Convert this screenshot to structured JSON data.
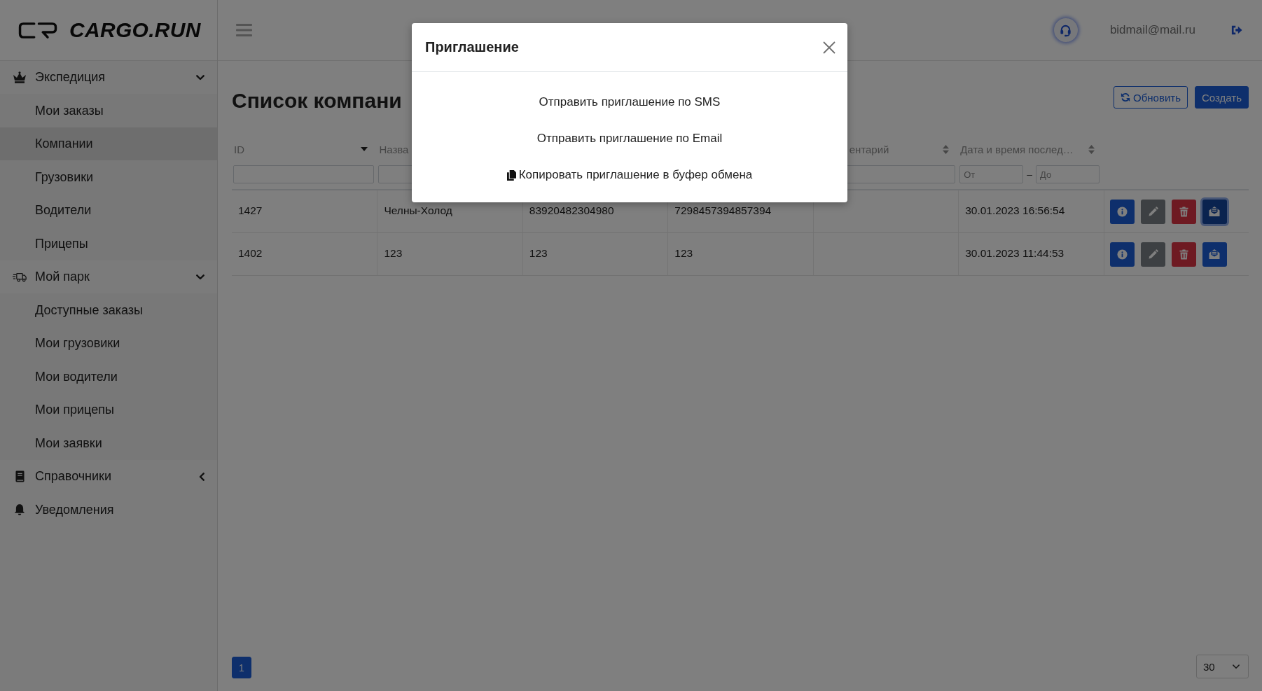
{
  "sidebar": {
    "logo": "CARGO.RUN",
    "items": [
      {
        "kind": "group",
        "label": "Экспедиция",
        "expanded": true,
        "children": [
          {
            "label": "Мои заказы",
            "selected": false
          },
          {
            "label": "Компании",
            "selected": true
          },
          {
            "label": "Грузовики",
            "selected": false
          },
          {
            "label": "Водители",
            "selected": false
          },
          {
            "label": "Прицепы",
            "selected": false
          }
        ]
      },
      {
        "kind": "group",
        "label": "Мой парк",
        "expanded": true,
        "children": [
          {
            "label": "Доступные заказы",
            "selected": false
          },
          {
            "label": "Мои грузовики",
            "selected": false
          },
          {
            "label": "Мои водители",
            "selected": false
          },
          {
            "label": "Мои прицепы",
            "selected": false
          },
          {
            "label": "Мои заявки",
            "selected": false
          }
        ]
      },
      {
        "kind": "group",
        "label": "Справочники",
        "expanded": false
      },
      {
        "kind": "link",
        "label": "Уведомления"
      }
    ]
  },
  "header": {
    "user_email": "bidmail@mail.ru"
  },
  "page": {
    "title": "Список компани",
    "buttons": [
      {
        "kind": "refresh",
        "label": "Обновить"
      },
      {
        "kind": "create",
        "label": "Создать"
      }
    ]
  },
  "table": {
    "columns": [
      {
        "kind": "data",
        "label": "ID",
        "sorted": true,
        "filter": {
          "kind": "text"
        }
      },
      {
        "kind": "data",
        "label": "Назва",
        "filter": {
          "kind": "text"
        }
      },
      {
        "kind": "covered"
      },
      {
        "kind": "covered"
      },
      {
        "kind": "data",
        "label": "ентарий",
        "sorted": false,
        "filter": {
          "kind": "text"
        }
      },
      {
        "kind": "data",
        "label": "Дата и время послед…",
        "sorted": false,
        "filter": {
          "kind": "range",
          "from_placeholder": "От",
          "separator": "–",
          "to_placeholder": "До"
        }
      },
      {
        "kind": "actions"
      }
    ],
    "rows": [
      {
        "cells": [
          "1427",
          "Челны-Холод",
          "83920482304980",
          "7298457394857394",
          null,
          "30.01.2023 16:56:54"
        ],
        "actions": [
          {
            "kind": "info",
            "active": false
          },
          {
            "kind": "edit",
            "active": false
          },
          {
            "kind": "delete",
            "active": false
          },
          {
            "kind": "invite",
            "active": true
          }
        ]
      },
      {
        "cells": [
          "1402",
          "123",
          "123",
          "123",
          null,
          "30.01.2023 11:44:53"
        ],
        "actions": [
          {
            "kind": "info",
            "active": false
          },
          {
            "kind": "edit",
            "active": false
          },
          {
            "kind": "delete",
            "active": false
          },
          {
            "kind": "invite",
            "active": false
          }
        ]
      }
    ]
  },
  "pagination": {
    "pages": [
      {
        "label": "1",
        "selected": true
      }
    ],
    "page_size": "30"
  },
  "modal": {
    "title": "Приглашение",
    "options": [
      {
        "kind": "sms",
        "label": "Отправить приглашение по SMS"
      },
      {
        "kind": "email",
        "label": "Отправить приглашение по Email"
      },
      {
        "kind": "copy",
        "label": "Копировать приглашение в буфер обмена"
      }
    ]
  }
}
